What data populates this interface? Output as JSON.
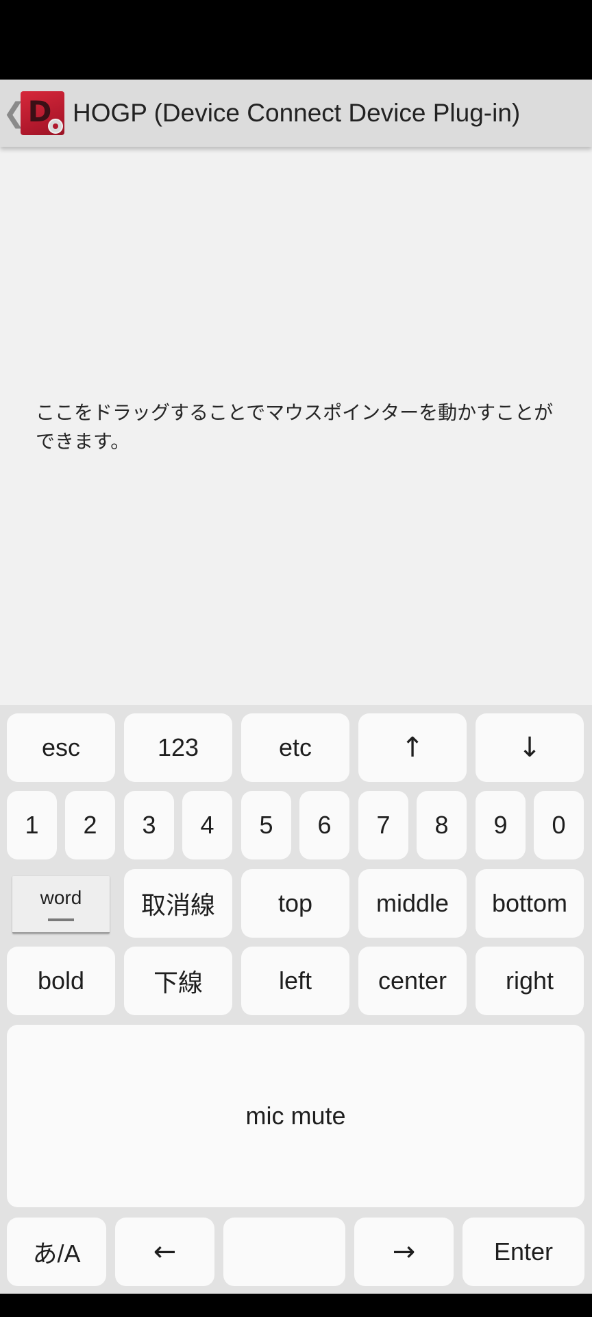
{
  "app": {
    "title": "HOGP (Device Connect Device Plug-in)",
    "back_glyph": "❮",
    "icon_letter": "D"
  },
  "touchpad": {
    "hint": "ここをドラッグすることでマウスポインターを動かすことができます。"
  },
  "keyboard": {
    "row1": {
      "esc": "esc",
      "num": "123",
      "etc": "etc",
      "up": "↑",
      "down": "↓"
    },
    "digits": [
      "1",
      "2",
      "3",
      "4",
      "5",
      "6",
      "7",
      "8",
      "9",
      "0"
    ],
    "row3": {
      "word": "word",
      "strike": "取消線",
      "top": "top",
      "middle": "middle",
      "bottom": "bottom"
    },
    "row4": {
      "bold": "bold",
      "underline": "下線",
      "left": "left",
      "center": "center",
      "right": "right"
    },
    "mic_mute": "mic mute",
    "row6": {
      "ime": "あ/A",
      "left_arrow": "←",
      "space": "",
      "right_arrow": "→",
      "enter": "Enter"
    }
  },
  "colors": {
    "accent_icon": "#c41f33",
    "action_bar": "#dcdcdc",
    "touch_area": "#f1f1f1",
    "keyboard_bg": "#e2e2e2",
    "key_bg": "#fafafa"
  }
}
